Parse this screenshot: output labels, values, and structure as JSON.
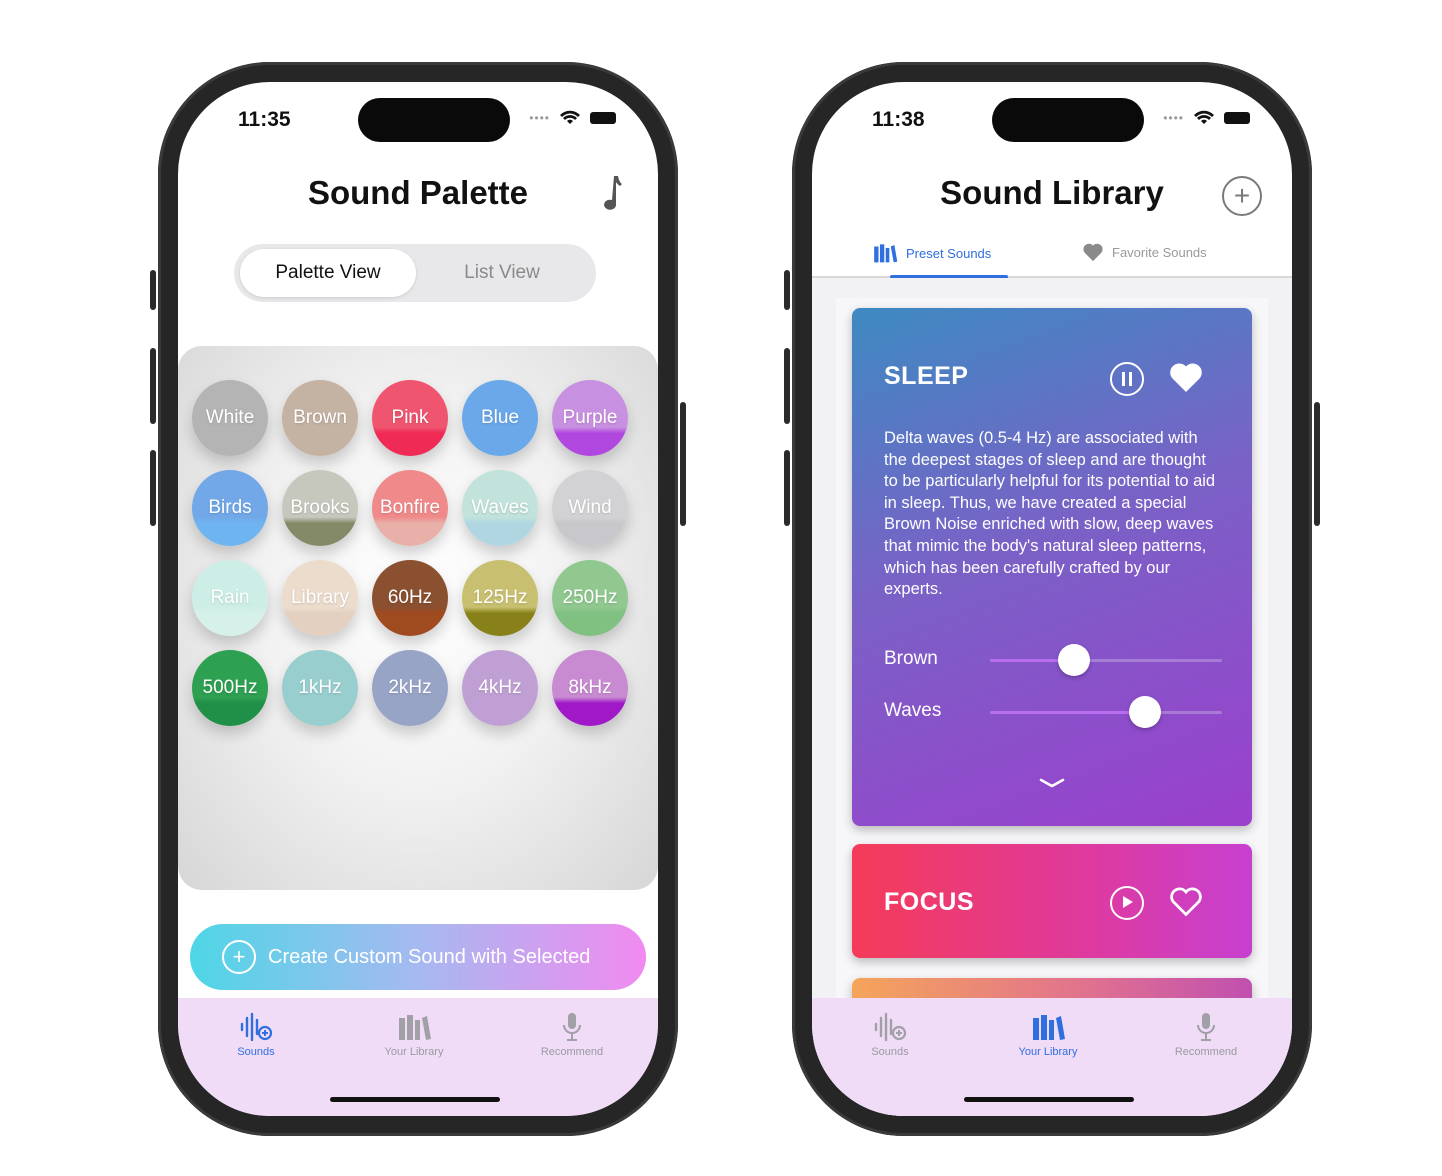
{
  "phone1": {
    "status": {
      "time": "11:35"
    },
    "title": "Sound Palette",
    "segment": {
      "active": "Palette View",
      "inactive": "List View"
    },
    "sounds": [
      {
        "label": "White",
        "color": "#b4b4b4",
        "bottom": "#b4b4b4"
      },
      {
        "label": "Brown",
        "color": "#c4b2a2",
        "bottom": "#c4b2a2"
      },
      {
        "label": "Pink",
        "color": "#f05570",
        "bottom": "#ee2a55"
      },
      {
        "label": "Blue",
        "color": "#6aa8ea",
        "bottom": "#6aa8ea"
      },
      {
        "label": "Purple",
        "color": "#c890e0",
        "bottom": "#b048e0"
      },
      {
        "label": "Birds",
        "color": "#72a8e8",
        "bottom": "#6db4f0"
      },
      {
        "label": "Brooks",
        "color": "#c6c8be",
        "bottom": "#848a68"
      },
      {
        "label": "Bonfire",
        "color": "#f08a8a",
        "bottom": "#e8b0a8"
      },
      {
        "label": "Waves",
        "color": "#c2e2dc",
        "bottom": "#b0d6e2"
      },
      {
        "label": "Wind",
        "color": "#d2d2d4",
        "bottom": "#c8c8cc"
      },
      {
        "label": "Rain",
        "color": "#cdeee6",
        "bottom": "#d6f0ea"
      },
      {
        "label": "Library",
        "color": "#ecdccc",
        "bottom": "#e4d0c0"
      },
      {
        "label": "60Hz",
        "color": "#8a5030",
        "bottom": "#a04a20"
      },
      {
        "label": "125Hz",
        "color": "#c8c070",
        "bottom": "#888018"
      },
      {
        "label": "250Hz",
        "color": "#90c890",
        "bottom": "#80c080"
      },
      {
        "label": "500Hz",
        "color": "#2ea052",
        "bottom": "#209048"
      },
      {
        "label": "1kHz",
        "color": "#98cece",
        "bottom": "#98cece"
      },
      {
        "label": "2kHz",
        "color": "#98a4c6",
        "bottom": "#98a4c6"
      },
      {
        "label": "4kHz",
        "color": "#c0a0d4",
        "bottom": "#c0a0d4"
      },
      {
        "label": "8kHz",
        "color": "#c88ad0",
        "bottom": "#a018c8"
      }
    ],
    "create_button": "Create Custom Sound with Selected",
    "tabs": [
      "Sounds",
      "Your Library",
      "Recommend"
    ],
    "active_tab": "Sounds"
  },
  "phone2": {
    "status": {
      "time": "11:38"
    },
    "title": "Sound Library",
    "library_tabs": {
      "preset": "Preset Sounds",
      "favorite": "Favorite Sounds"
    },
    "sleep": {
      "title": "SLEEP",
      "description": "Delta waves (0.5-4 Hz) are associated with the deepest stages of sleep and are thought to be particularly helpful for its potential to aid in sleep. Thus, we have created a special Brown Noise enriched with slow, deep waves that mimic the body's natural sleep patterns, which has been carefully crafted by our experts.",
      "sliders": [
        {
          "label": "Brown",
          "value": 0.36
        },
        {
          "label": "Waves",
          "value": 0.67
        }
      ]
    },
    "focus": {
      "title": "FOCUS"
    },
    "tabs": [
      "Sounds",
      "Your Library",
      "Recommend"
    ],
    "active_tab": "Your Library"
  },
  "colors": {
    "accent": "#2f6fe0",
    "tabbar": "#f0dcf7"
  }
}
